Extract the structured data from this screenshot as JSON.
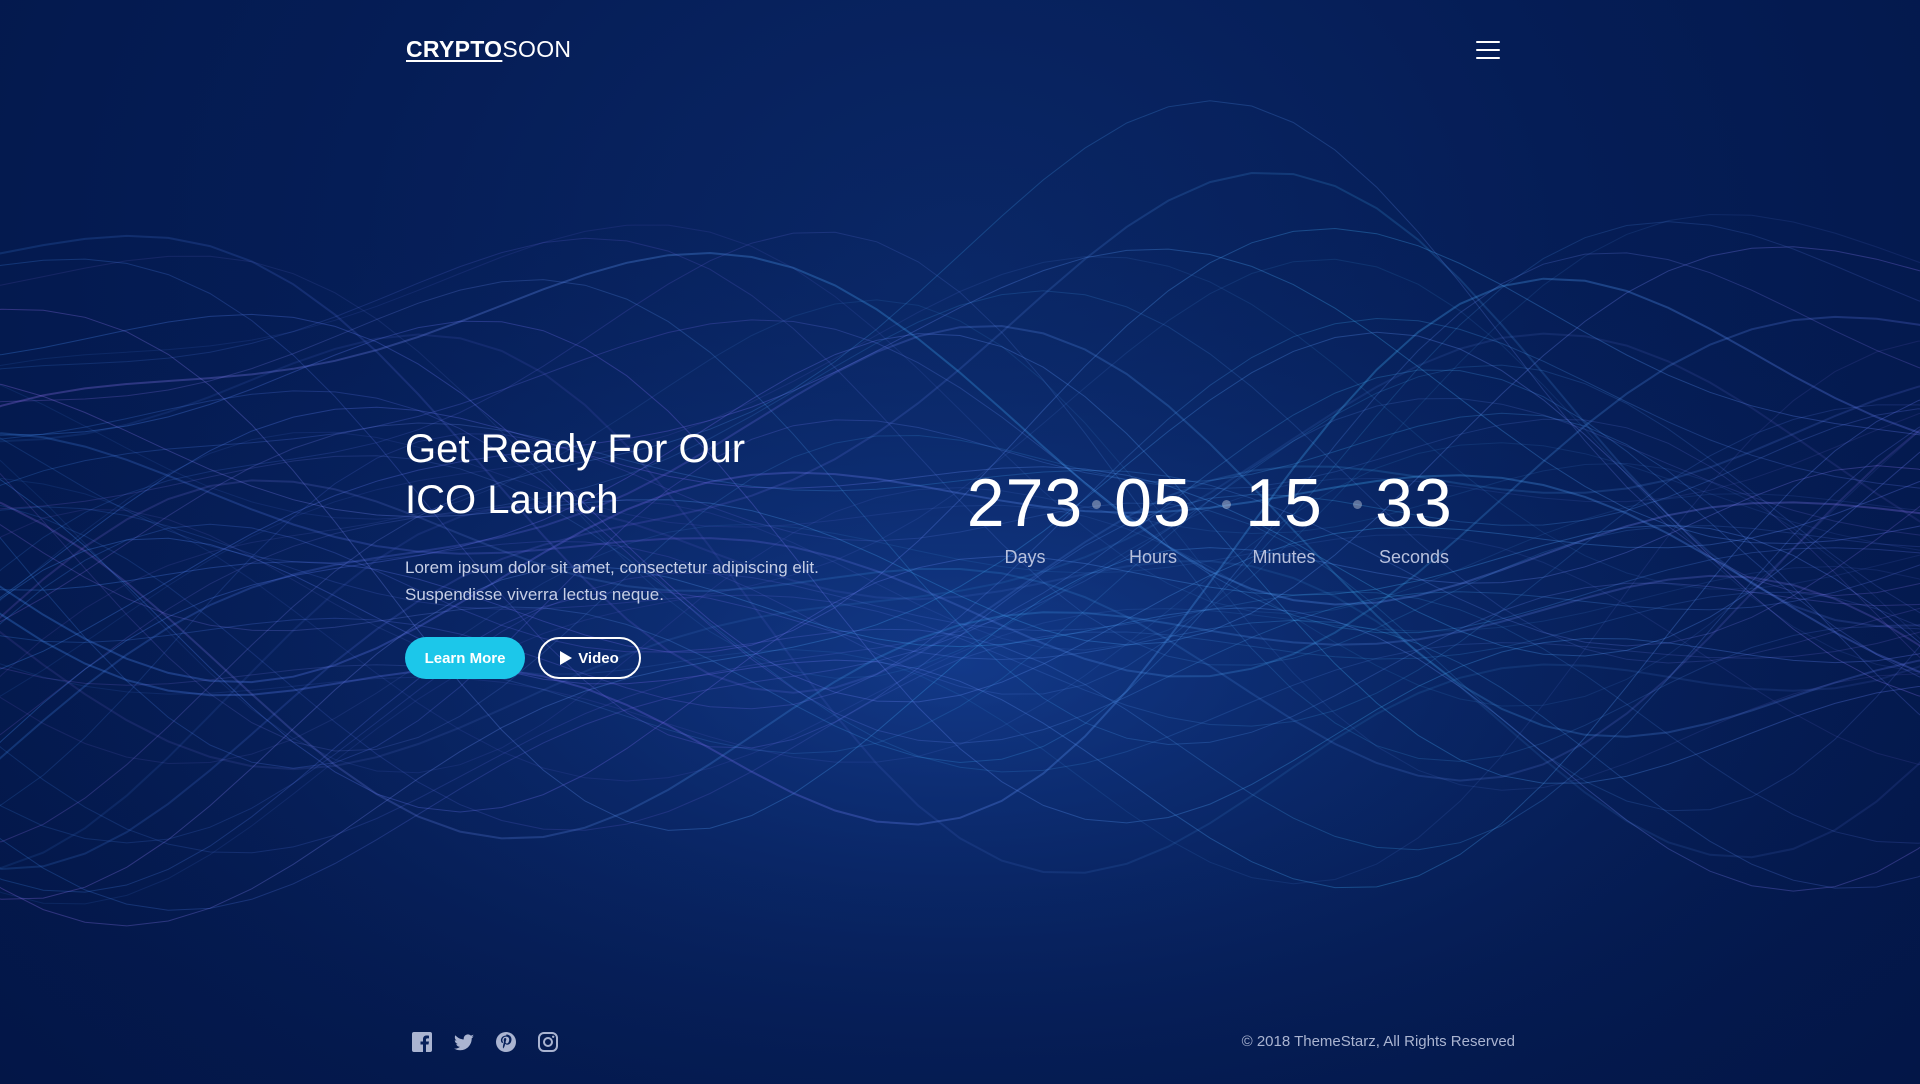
{
  "header": {
    "logo_bold": "CRYPTO",
    "logo_light": "SOON",
    "menu_icon": "hamburger-menu-icon"
  },
  "hero": {
    "title_line1": "Get Ready For Our",
    "title_line2": "ICO Launch",
    "text_line1": "Lorem ipsum dolor sit amet, consectetur adipiscing elit.",
    "text_line2": "Suspendisse viverra lectus neque.",
    "learn_more_label": "Learn More",
    "video_label": "Video",
    "video_icon": "play-icon"
  },
  "countdown": [
    {
      "value": "273",
      "label": "Days"
    },
    {
      "value": "05",
      "label": "Hours"
    },
    {
      "value": "15",
      "label": "Minutes"
    },
    {
      "value": "33",
      "label": "Seconds"
    }
  ],
  "footer": {
    "social_icons": [
      "facebook-icon",
      "twitter-icon",
      "pinterest-icon",
      "instagram-icon"
    ],
    "copyright": "© 2018 ThemeStarz, All Rights Reserved"
  },
  "colors": {
    "background": "#041a4d",
    "accent": "#1cc7ea",
    "wave_blue": "#3fa9f5",
    "wave_purple": "#8a6cf0",
    "muted_text": "#b8c1dd"
  }
}
